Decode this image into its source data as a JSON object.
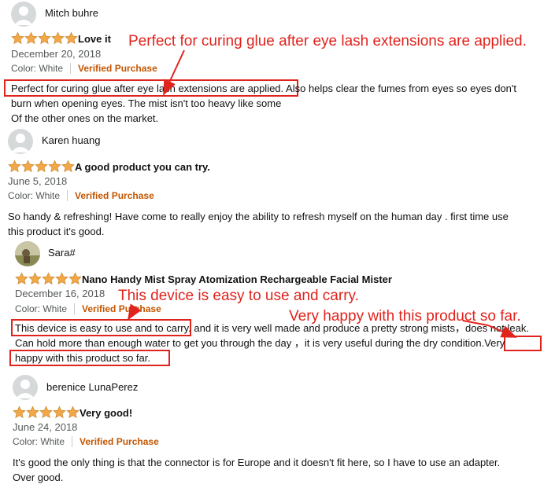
{
  "reviews": [
    {
      "name": "Mitch buhre",
      "title": "Love it",
      "date": "December 20, 2018",
      "color": "Color: White",
      "verified": "Verified Purchase",
      "body_highlight": "Perfect for curing glue after eye lash extensions are applied.",
      "body_line1_rest": " Also helps clear the fumes from eyes so eyes don't",
      "body_line2": "burn when opening eyes. The mist isn't too heavy like some",
      "body_line3": "Of the other ones on the market.",
      "rating": 5
    },
    {
      "name": "Karen huang",
      "title": "A good product you can try.",
      "date": "June 5, 2018",
      "color": "Color: White",
      "verified": "Verified Purchase",
      "body_line1": "So handy & refreshing! Have come to really enjoy the ability to refresh myself on the human day . first time use",
      "body_line2": "this product it's good.",
      "rating": 5
    },
    {
      "name": "Sara#",
      "title": "Nano Handy Mist Spray Atomization Rechargeable Facial Mister",
      "date": "December 16, 2018",
      "color": "Color: White",
      "verified": "Verified Purchase",
      "body_highlight1": "This device is easy to use and to carry.",
      "body_line1_rest": " and it is very well made and produce a pretty strong mists，does not leak.",
      "body_line2_main": "Can hold more than enough water to get you through the day ，it is very useful during the dry condition.",
      "body_line2_hl": "Very",
      "body_line3_hl": "happy with this product so far.",
      "rating": 5
    },
    {
      "name": "berenice LunaPerez",
      "title": "Very good!",
      "date": "June 24, 2018",
      "color": "Color: White",
      "verified": "Verified Purchase",
      "body_line1": "It's good the only thing is that the connector is for Europe and it doesn't fit here, so I have to use an adapter.",
      "body_line2": "Over good.",
      "rating": 5
    }
  ],
  "annotations": {
    "a1": "Perfect for curing glue after eye lash extensions are applied.",
    "a2": "This device is easy to use and carry.",
    "a3": "Very happy with this product so far."
  },
  "colors": {
    "annotation_red": "#e1231d",
    "star_orange": "#f3a847",
    "verified": "#c45500",
    "meta_gray": "#565959"
  }
}
